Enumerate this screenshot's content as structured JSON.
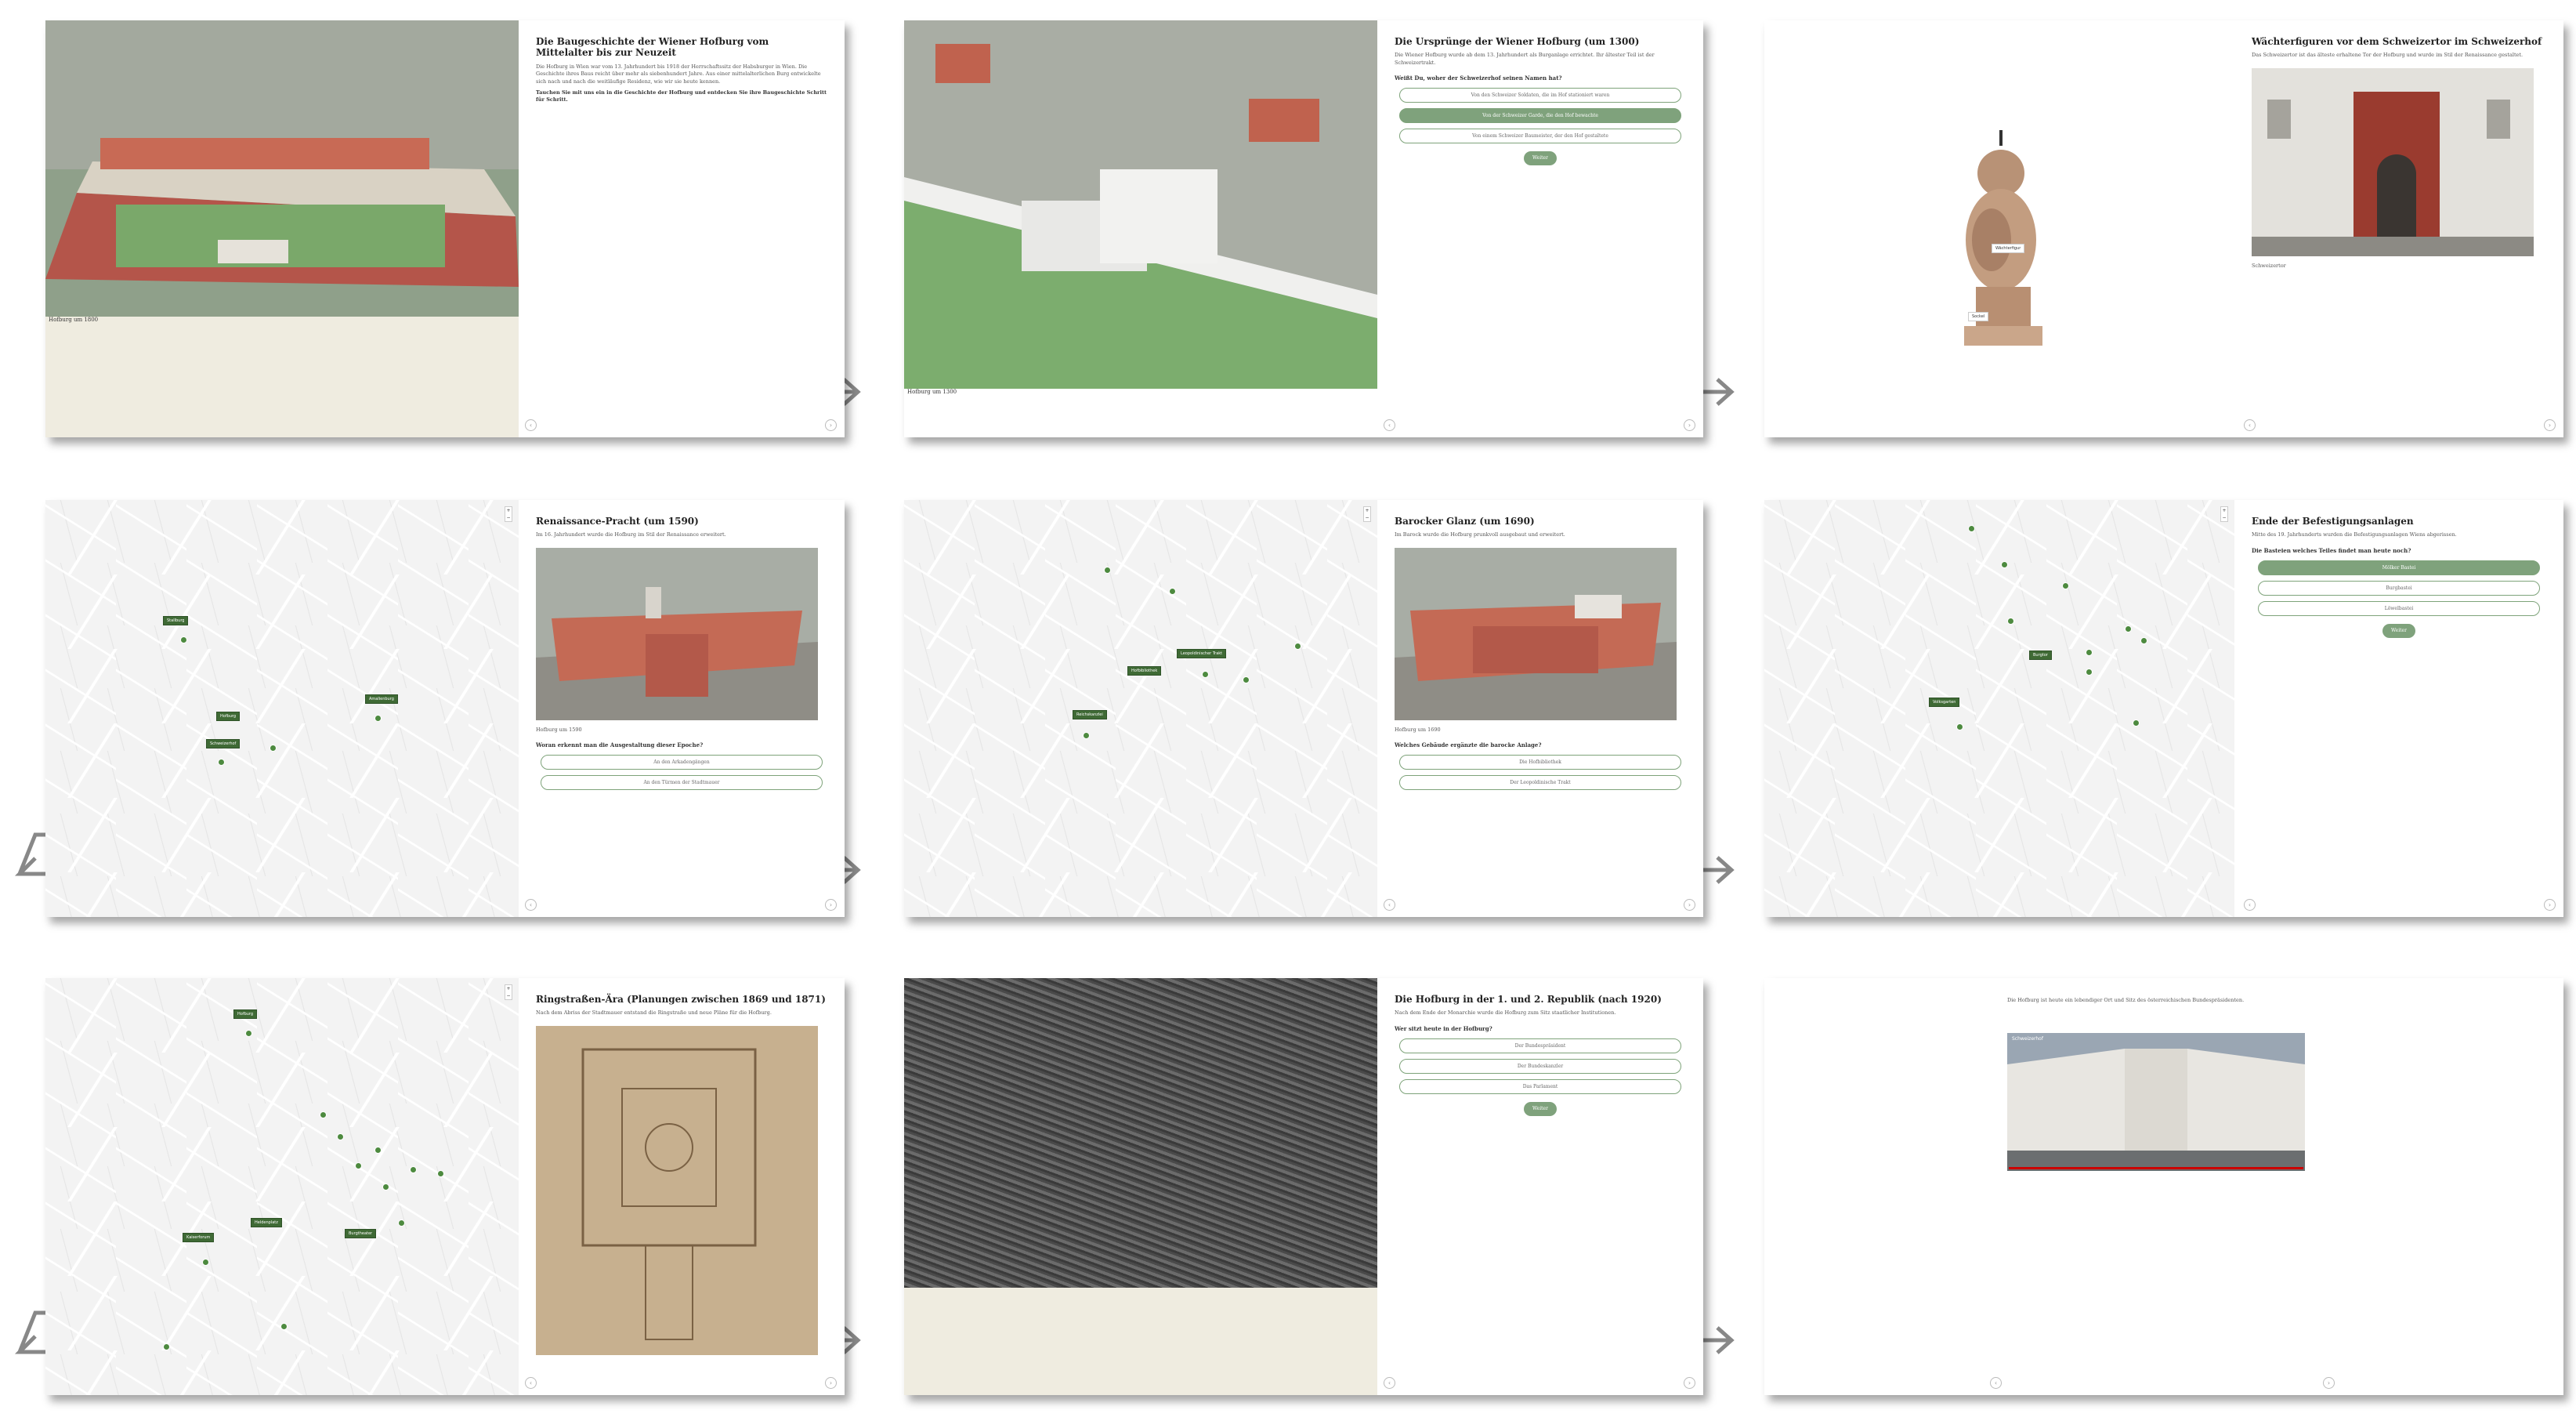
{
  "p1": {
    "title": "Die Baugeschichte der Wiener Hofburg vom Mittelalter bis zur Neuzeit",
    "text": "Die Hofburg in Wien war vom 13. Jahrhundert bis 1918 der Herrschaftssitz der Habsburger in Wien. Die Geschichte ihres Baus reicht über mehr als siebenhundert Jahre. Aus einer mittelalterlichen Burg entwickelte sich nach und nach die weitläufige Residenz, wie wir sie heute kennen.",
    "bold": "Tauchen Sie mit uns ein in die Geschichte der Hofburg und entdecken Sie ihre Baugeschichte Schritt für Schritt.",
    "caption": "Hofburg um 1800"
  },
  "p2": {
    "title": "Die Ursprünge der Wiener Hofburg (um 1300)",
    "text": "Die Wiener Hofburg wurde ab dem 13. Jahrhundert als Burganlage errichtet. Ihr ältester Teil ist der Schweizertrakt.",
    "q": "Weißt Du, woher der Schweizerhof seinen Namen hat?",
    "options": [
      "Von den Schweizer Soldaten, die im Hof stationiert waren",
      "Von der Schweizer Garde, die den Hof bewachte",
      "Von einem Schweizer Baumeister, der den Hof gestaltete"
    ],
    "submit": "Weiter",
    "caption": "Hofburg um 1300"
  },
  "p3": {
    "title": "Wächterfiguren vor dem Schweizertor im Schweizerhof",
    "text": "Das Schweizertor ist das älteste erhaltene Tor der Hofburg und wurde im Stil der Renaissance gestaltet.",
    "caption": "Schweizertor",
    "label1": "Wächterfigur",
    "label2": "Sockel"
  },
  "p4": {
    "title": "Renaissance-Pracht (um 1590)",
    "text": "Im 16. Jahrhundert wurde die Hofburg im Stil der Renaissance erweitert.",
    "caption": "Hofburg um 1590",
    "q": "Woran erkennt man die Ausgestaltung dieser Epoche?",
    "options": [
      "An den Arkadengängen",
      "An den Türmen der Stadtmauer"
    ],
    "markers": [
      "Stallburg",
      "Amalienburg",
      "Hofburg",
      "Schweizerhof"
    ]
  },
  "p5": {
    "title": "Barocker Glanz (um 1690)",
    "text": "Im Barock wurde die Hofburg prunkvoll ausgebaut und erweitert.",
    "caption": "Hofburg um 1690",
    "q": "Welches Gebäude ergänzte die barocke Anlage?",
    "options": [
      "Die Hofbibliothek",
      "Der Leopoldinische Trakt"
    ],
    "markers": [
      "Leopoldinischer Trakt",
      "Hofbibliothek",
      "Reichskanzlei"
    ]
  },
  "p6": {
    "title": "Ende der Befestigungsanlagen",
    "text": "Mitte des 19. Jahrhunderts wurden die Befestigungsanlagen Wiens abgerissen.",
    "q": "Die Basteien welches Teiles findet man heute noch?",
    "options": [
      "Mölker Bastei",
      "Burgbastei",
      "Löwelbastei"
    ],
    "submit": "Weiter",
    "markers": [
      "Burgtor",
      "Volksgarten"
    ]
  },
  "p7": {
    "title": "Ringstraßen-Ära (Planungen zwischen 1869 und 1871)",
    "text": "Nach dem Abriss der Stadtmauer entstand die Ringstraße und neue Pläne für die Hofburg.",
    "markers": [
      "Hofburg",
      "Heldenplatz",
      "Kaiserforum",
      "Burgtheater"
    ]
  },
  "p8": {
    "title": "Die Hofburg in der 1. und 2. Republik (nach 1920)",
    "text": "Nach dem Ende der Monarchie wurde die Hofburg zum Sitz staatlicher Institutionen.",
    "q": "Wer sitzt heute in der Hofburg?",
    "options": [
      "Der Bundespräsident",
      "Der Bundeskanzler",
      "Das Parlament"
    ],
    "submit": "Weiter"
  },
  "p9": {
    "text": "Die Hofburg ist heute ein lebendiger Ort und Sitz des österreichischen Bundespräsidenten.",
    "video": "Schweizerhof"
  }
}
